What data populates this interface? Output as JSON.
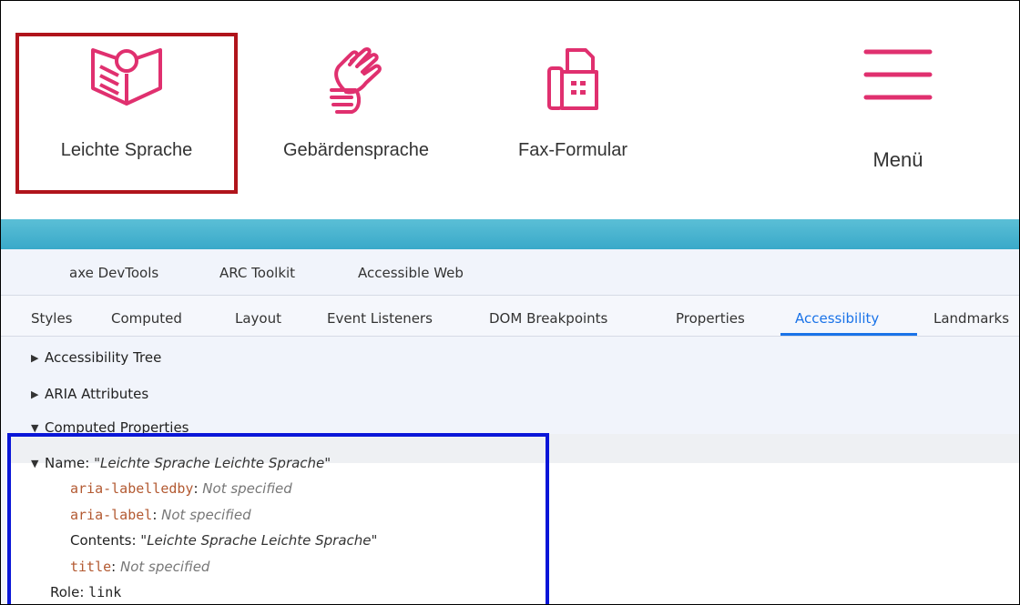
{
  "colors": {
    "accent_pink": "#e0306f",
    "highlight_red": "#b0141b",
    "highlight_blue": "#0a16d8",
    "teal": "#3aa9c9",
    "tab_active": "#1a73e8"
  },
  "site_nav": {
    "items": [
      {
        "label": "Leichte Sprache",
        "icon": "open-book-person-icon"
      },
      {
        "label": "Gebärdensprache",
        "icon": "sign-language-hands-icon"
      },
      {
        "label": "Fax-Formular",
        "icon": "fax-icon"
      }
    ],
    "menu": {
      "label": "Menü",
      "icon": "hamburger-menu-icon"
    }
  },
  "devtools": {
    "extension_tabs": [
      "axe DevTools",
      "ARC Toolkit",
      "Accessible Web"
    ],
    "panel_tabs": [
      "Styles",
      "Computed",
      "Layout",
      "Event Listeners",
      "DOM Breakpoints",
      "Properties",
      "Accessibility",
      "Landmarks"
    ],
    "active_panel_tab": "Accessibility",
    "sections": {
      "accessibility_tree": "Accessibility Tree",
      "aria_attributes": "ARIA Attributes",
      "computed_properties": "Computed Properties"
    },
    "computed": {
      "name_label": "Name: ",
      "name_value": "\"Leichte Sprache Leichte Sprache\"",
      "labelledby_attr": "aria-labelledby",
      "labelledby_value": "Not specified",
      "label_attr": "aria-label",
      "label_value": "Not specified",
      "contents_label": "Contents: ",
      "contents_value": "\"Leichte Sprache Leichte Sprache\"",
      "title_attr": "title",
      "title_value": "Not specified",
      "role_label": "Role: ",
      "role_value": "link"
    }
  }
}
